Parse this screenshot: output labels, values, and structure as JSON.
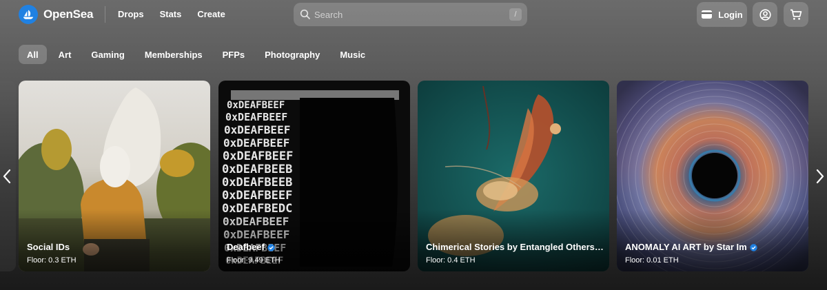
{
  "brand": {
    "name": "OpenSea",
    "accent": "#2081e2"
  },
  "nav": {
    "items": [
      "Drops",
      "Stats",
      "Create"
    ]
  },
  "search": {
    "placeholder": "Search",
    "shortcut": "/"
  },
  "account": {
    "login_label": "Login",
    "profile_icon": "profile-icon",
    "cart_icon": "cart-icon"
  },
  "categories": {
    "selected": "All",
    "items": [
      "All",
      "Art",
      "Gaming",
      "Memberships",
      "PFPs",
      "Photography",
      "Music"
    ]
  },
  "carousel": {
    "cards": [
      {
        "name": "Social IDs",
        "floor": "Floor: 0.3 ETH",
        "verified": false
      },
      {
        "name": "Deafbeef",
        "floor": "Floor: 9.49 ETH",
        "verified": true
      },
      {
        "name": "Chimerical Stories by Entangled Others (Sofia…",
        "floor": "Floor: 0.4 ETH",
        "verified": false
      },
      {
        "name": "ANOMALY AI ART by Star Im",
        "floor": "Floor: 0.01 ETH",
        "verified": true
      }
    ],
    "deafbeef_text": "0xDEAFBEEF"
  }
}
